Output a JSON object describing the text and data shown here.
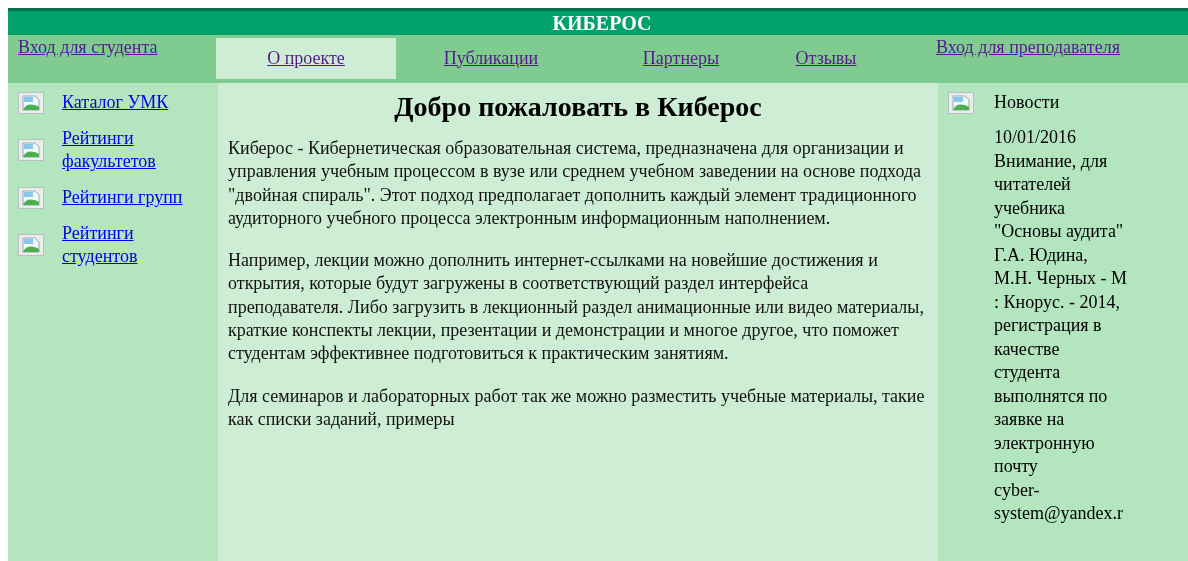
{
  "site_title": "КИБЕРОС",
  "nav": {
    "student_login": "Вход для студента",
    "tabs": [
      {
        "label": "О проекте",
        "selected": true
      },
      {
        "label": "Публикации",
        "selected": false
      },
      {
        "label": "Партнеры",
        "selected": false
      },
      {
        "label": "Отзывы",
        "selected": false
      }
    ],
    "teacher_login": "Вход для преподавателя"
  },
  "sidebar": {
    "items": [
      {
        "label": "Каталог УМК"
      },
      {
        "label": "Рейтинги факультетов"
      },
      {
        "label": "Рейтинги групп"
      },
      {
        "label": "Рейтинги студентов"
      }
    ]
  },
  "main": {
    "heading": "Добро пожаловать в Киберос",
    "paragraphs": [
      "Киберос - Кибернетическая образовательная система, предназначена для организации и управления учебным процессом в вузе или среднем учебном заведении на основе подхода \"двойная спираль\". Этот подход предполагает дополнить каждый элемент традиционного аудиторного учебного процесса электронным информационным наполнением.",
      "Например, лекции можно дополнить интернет-ссылками на новейшие достижения и открытия, которые будут загружены в соответствующий раздел интерфейса преподавателя. Либо загрузить в лекционный раздел анимационные или видео материалы, краткие конспекты лекции, презентации и демонстрации и многое другое, что поможет студентам эффективнее подготовиться к практическим занятиям.",
      "Для семинаров и лабораторных работ так же можно разместить учебные материалы, такие как списки заданий, примеры"
    ]
  },
  "news": {
    "title": "Новости",
    "lines": [
      "10/01/2016",
      "Внимание, для",
      "читателей",
      "учебника",
      "\"Основы аудита\"",
      "Г.А. Юдина,",
      "М.Н. Черных - М",
      ": Кнорус. - 2014,",
      "регистрация в",
      "качестве",
      "студента",
      "выполнятся по",
      "заявке на",
      "электронную",
      "почту",
      "cyber-",
      "system@yandex.r"
    ]
  }
}
